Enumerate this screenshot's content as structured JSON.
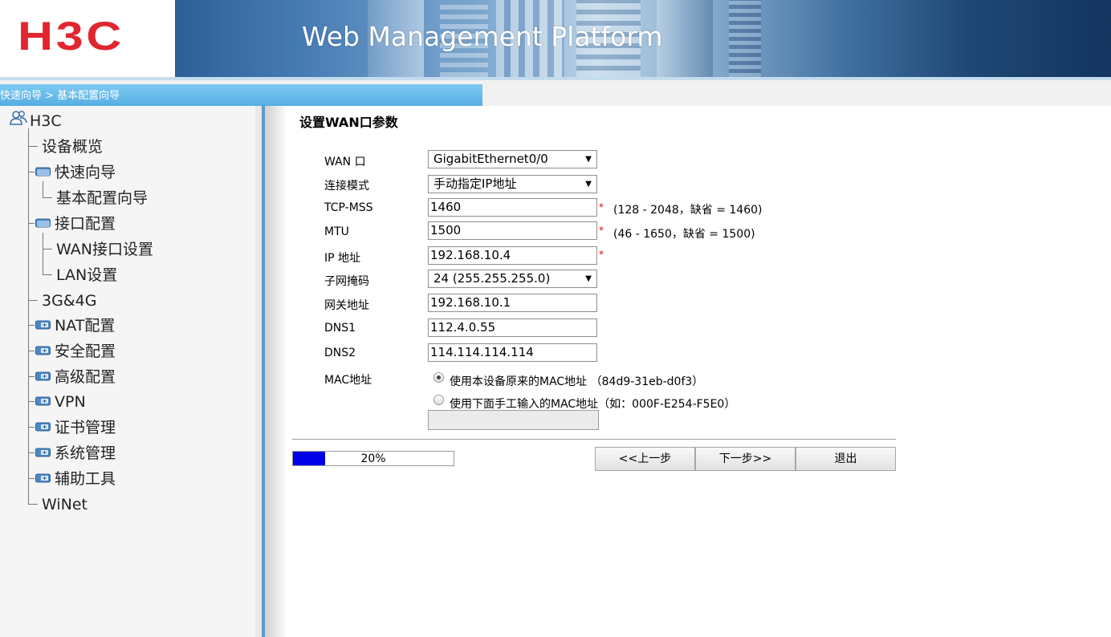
{
  "header": {
    "logo_text": "H3C",
    "title": "Web Management Platform"
  },
  "breadcrumb": "快速向导 > 基本配置向导",
  "sidebar": {
    "root": "H3C",
    "items": [
      {
        "label": "设备概览",
        "type": "leaf"
      },
      {
        "label": "快速向导",
        "type": "folder-open"
      },
      {
        "label": "基本配置向导",
        "type": "child"
      },
      {
        "label": "接口配置",
        "type": "folder-open"
      },
      {
        "label": "WAN接口设置",
        "type": "child"
      },
      {
        "label": "LAN设置",
        "type": "child"
      },
      {
        "label": "3G&4G",
        "type": "leaf"
      },
      {
        "label": "NAT配置",
        "type": "folder-closed"
      },
      {
        "label": "安全配置",
        "type": "folder-closed"
      },
      {
        "label": "高级配置",
        "type": "folder-closed"
      },
      {
        "label": "VPN",
        "type": "folder-closed"
      },
      {
        "label": "证书管理",
        "type": "folder-closed"
      },
      {
        "label": "系统管理",
        "type": "folder-closed"
      },
      {
        "label": "辅助工具",
        "type": "folder-closed"
      },
      {
        "label": "WiNet",
        "type": "leaf"
      }
    ]
  },
  "form": {
    "title": "设置WAN口参数",
    "wan_port": {
      "label": "WAN 口",
      "value": "GigabitEthernet0/0"
    },
    "conn_mode": {
      "label": "连接模式",
      "value": "手动指定IP地址"
    },
    "tcp_mss": {
      "label": "TCP-MSS",
      "value": "1460",
      "required": "*",
      "hint": "(128 - 2048，缺省 = 1460)"
    },
    "mtu": {
      "label": "MTU",
      "value": "1500",
      "required": "*",
      "hint": "(46 - 1650，缺省 = 1500)"
    },
    "ip": {
      "label": "IP 地址",
      "value": "192.168.10.4",
      "required": "*"
    },
    "mask": {
      "label": "子网掩码",
      "value": "24 (255.255.255.0)"
    },
    "gateway": {
      "label": "网关地址",
      "value": "192.168.10.1"
    },
    "dns1": {
      "label": "DNS1",
      "value": "112.4.0.55"
    },
    "dns2": {
      "label": "DNS2",
      "value": "114.114.114.114"
    },
    "mac": {
      "label": "MAC地址",
      "option_original": "使用本设备原来的MAC地址  （84d9-31eb-d0f3）",
      "option_manual": "使用下面手工输入的MAC地址（如：000F-E254-F5E0）",
      "selected": "original",
      "manual_value": ""
    }
  },
  "progress": {
    "percent": 20,
    "label": "20%"
  },
  "buttons": {
    "prev": "<<上一步",
    "next": "下一步>>",
    "exit": "退出"
  },
  "colors": {
    "logo_red": "#e2262f",
    "breadcrumb_blue": "#55aee3",
    "progress_fill": "#0000e6"
  }
}
